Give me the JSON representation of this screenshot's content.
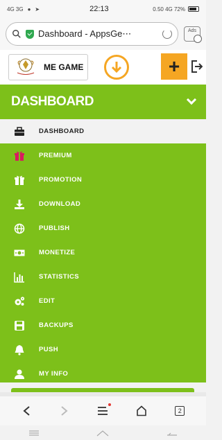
{
  "status": {
    "time": "22:13",
    "left": "4G 3G",
    "right": "0.50 4G 72%"
  },
  "browser": {
    "url_text": "Dashboard - AppsGe⋯",
    "ads_label": "Ads"
  },
  "header": {
    "brand_name": "ME GAME"
  },
  "menu": {
    "title": "DASHBOARD",
    "items": [
      {
        "label": "DASHBOARD",
        "icon": "briefcase-icon",
        "active": true
      },
      {
        "label": "PREMIUM",
        "icon": "gift-icon"
      },
      {
        "label": "PROMOTION",
        "icon": "gift-icon"
      },
      {
        "label": "DOWNLOAD",
        "icon": "download-icon"
      },
      {
        "label": "PUBLISH",
        "icon": "globe-icon"
      },
      {
        "label": "MONETIZE",
        "icon": "money-icon"
      },
      {
        "label": "STATISTICS",
        "icon": "bar-chart-icon"
      },
      {
        "label": "EDIT",
        "icon": "gears-icon"
      },
      {
        "label": "BACKUPS",
        "icon": "save-icon"
      },
      {
        "label": "PUSH",
        "icon": "bell-icon"
      },
      {
        "label": "MY INFO",
        "icon": "user-icon"
      }
    ]
  },
  "bottom": {
    "tab_count": "2"
  },
  "colors": {
    "menu_green": "#7dc01a",
    "accent_orange": "#f5a623",
    "gift_red": "#d81b60"
  }
}
